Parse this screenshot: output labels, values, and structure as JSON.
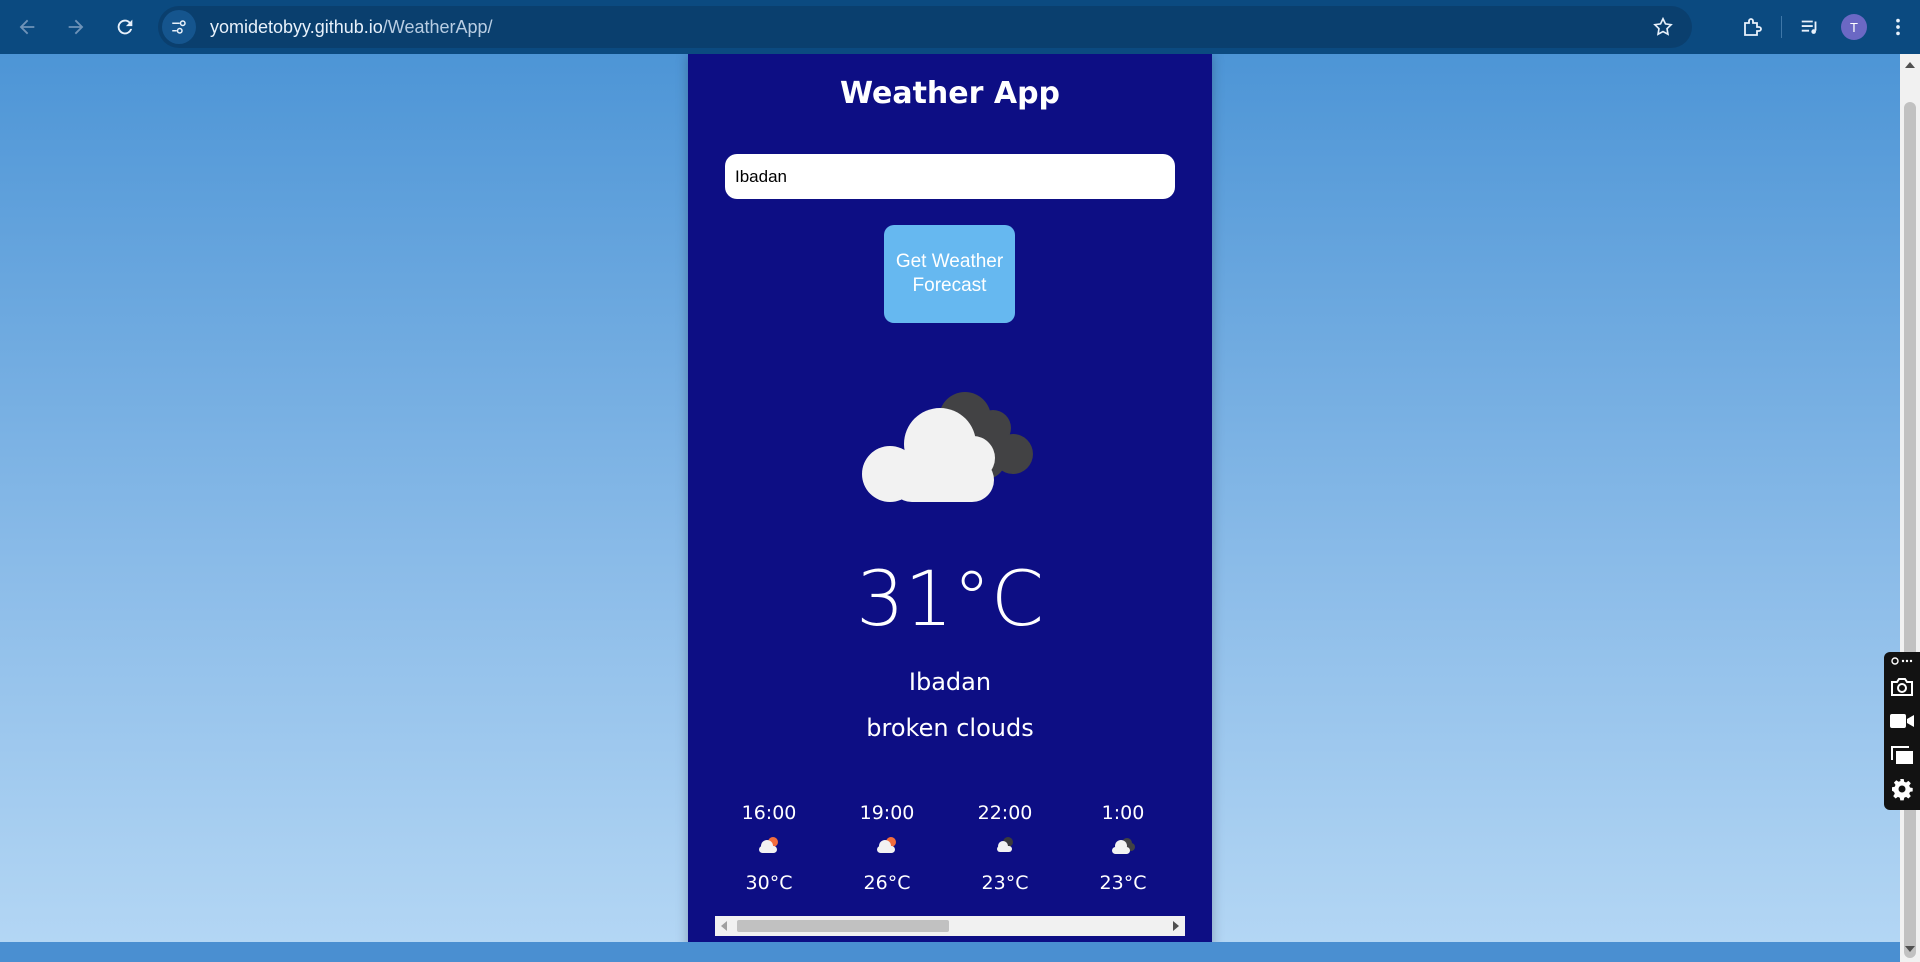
{
  "browser": {
    "url_host": "yomidetobyy.github.io",
    "url_path": "/WeatherApp/",
    "profile_initial": "T",
    "icons": [
      "back-icon",
      "forward-icon",
      "reload-icon",
      "site-settings-icon",
      "bookmark-star-icon",
      "extensions-icon",
      "media-queue-icon",
      "more-menu-icon"
    ]
  },
  "app": {
    "title": "Weather App",
    "search_value": "Ibadan",
    "button_label": "Get Weather Forecast",
    "current": {
      "temperature": "31°C",
      "city": "Ibadan",
      "description": "broken clouds",
      "icon": "broken-clouds-icon"
    },
    "hourly": [
      {
        "time": "16:00",
        "temp": "30°C",
        "icon": "few-clouds-day-icon"
      },
      {
        "time": "19:00",
        "temp": "26°C",
        "icon": "few-clouds-day-icon"
      },
      {
        "time": "22:00",
        "temp": "23°C",
        "icon": "few-clouds-night-icon"
      },
      {
        "time": "1:00",
        "temp": "23°C",
        "icon": "broken-clouds-icon"
      }
    ],
    "hourly_scroll_fraction": 0.45
  },
  "floating_toolbar": {
    "items": [
      "pin-icon",
      "camera-icon",
      "video-icon",
      "windows-icon",
      "settings-icon"
    ]
  },
  "colors": {
    "chrome": "#0b4a80",
    "card": "#0d0e84",
    "button": "#66b8f0",
    "text": "#ffffff"
  }
}
